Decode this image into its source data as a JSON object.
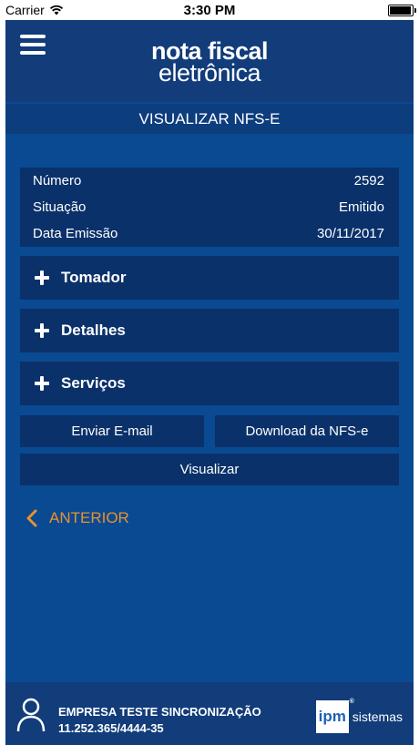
{
  "status_bar": {
    "carrier": "Carrier",
    "time": "3:30 PM"
  },
  "header": {
    "logo_line1": "nota fiscal",
    "logo_line2": "eletrônica"
  },
  "page_title": "VISUALIZAR NFS-E",
  "info": [
    {
      "label": "Número",
      "value": "2592"
    },
    {
      "label": "Situação",
      "value": "Emitido"
    },
    {
      "label": "Data Emissão",
      "value": "30/11/2017"
    }
  ],
  "sections": [
    {
      "label": "Tomador"
    },
    {
      "label": "Detalhes"
    },
    {
      "label": "Serviços"
    }
  ],
  "buttons": {
    "send_email": "Enviar E-mail",
    "download": "Download da NFS-e",
    "view": "Visualizar"
  },
  "back_label": "ANTERIOR",
  "footer": {
    "company_name": "EMPRESA TESTE SINCRONIZAÇÃO",
    "company_id": "11.252.365/4444-35",
    "brand_mark": "ipm",
    "brand_text": "sistemas"
  },
  "colors": {
    "background": "#0a4a92",
    "header": "#123c7a",
    "card": "#0a316a",
    "accent": "#e8922e"
  }
}
